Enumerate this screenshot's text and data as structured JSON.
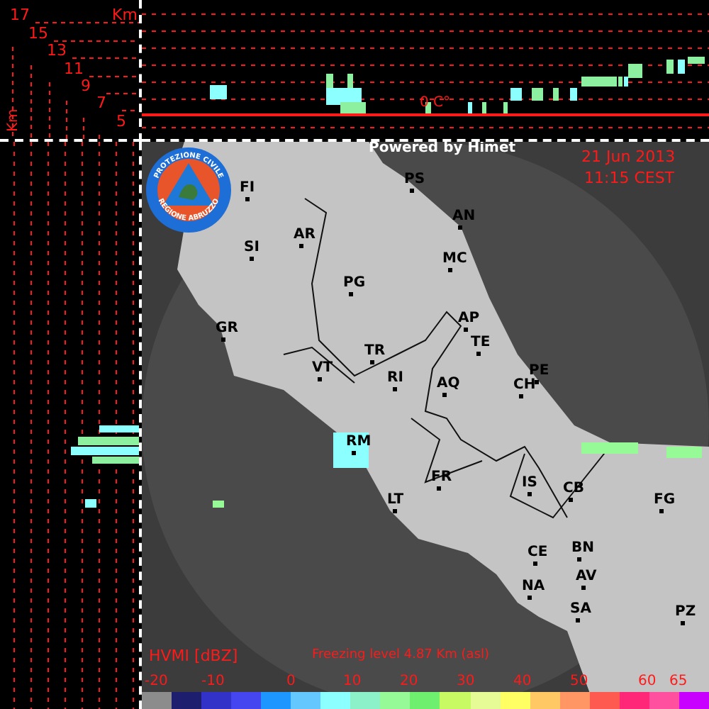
{
  "profile": {
    "unit": "Km",
    "axis_label": "Km",
    "ticks": [
      "17",
      "15",
      "13",
      "11",
      "9",
      "7",
      "5"
    ],
    "freezing_marker": "0 C°"
  },
  "map": {
    "credit": "Powered by Himet",
    "date": "21 Jun 2013",
    "time": "11:15 CEST",
    "logo": {
      "top_text": "PROTEZIONE CIVILE",
      "bottom_text": "REGIONE ABRUZZO"
    },
    "cities": [
      {
        "label": "FI"
      },
      {
        "label": "PS"
      },
      {
        "label": "AR"
      },
      {
        "label": "SI"
      },
      {
        "label": "AN"
      },
      {
        "label": "MC"
      },
      {
        "label": "PG"
      },
      {
        "label": "GR"
      },
      {
        "label": "AP"
      },
      {
        "label": "TE"
      },
      {
        "label": "TR"
      },
      {
        "label": "VT"
      },
      {
        "label": "RI"
      },
      {
        "label": "AQ"
      },
      {
        "label": "PE"
      },
      {
        "label": "CH"
      },
      {
        "label": "RM"
      },
      {
        "label": "FR"
      },
      {
        "label": "LT"
      },
      {
        "label": "IS"
      },
      {
        "label": "CB"
      },
      {
        "label": "FG"
      },
      {
        "label": "CE"
      },
      {
        "label": "BN"
      },
      {
        "label": "AV"
      },
      {
        "label": "NA"
      },
      {
        "label": "SA"
      },
      {
        "label": "PZ"
      }
    ]
  },
  "legend": {
    "title": "HVMI [dBZ]",
    "freezing_level": "Freezing level  4.87 Km (asl)",
    "tick_labels": [
      "-20",
      "-10",
      "0",
      "10",
      "20",
      "30",
      "40",
      "50",
      "60",
      "65"
    ],
    "bins": [
      {
        "color": "#8c8c8c"
      },
      {
        "color": "#1e1e6e"
      },
      {
        "color": "#3232c8"
      },
      {
        "color": "#4646f0"
      },
      {
        "color": "#1e96ff"
      },
      {
        "color": "#64c8ff"
      },
      {
        "color": "#8cffff"
      },
      {
        "color": "#8cf0c8"
      },
      {
        "color": "#96fa96"
      },
      {
        "color": "#6ef06e"
      },
      {
        "color": "#c8fa64"
      },
      {
        "color": "#e6fa96"
      },
      {
        "color": "#ffff64"
      },
      {
        "color": "#ffc864"
      },
      {
        "color": "#ff9664"
      },
      {
        "color": "#ff5a50"
      },
      {
        "color": "#ff2878"
      },
      {
        "color": "#ff50a0"
      },
      {
        "color": "#c800ff"
      }
    ]
  }
}
